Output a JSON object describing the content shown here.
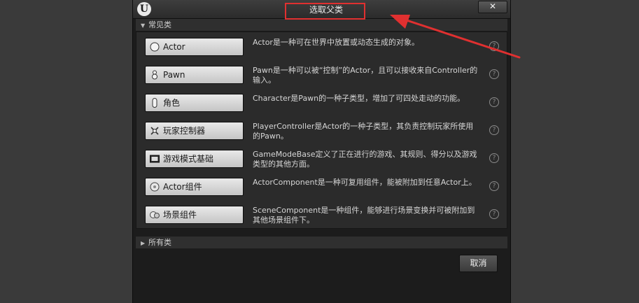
{
  "window": {
    "title": "选取父类",
    "close_label": "✕"
  },
  "common_section": {
    "label": "常见类"
  },
  "all_section": {
    "label": "所有类"
  },
  "classes": [
    {
      "label": "Actor",
      "icon": "actor-sphere-icon",
      "description": "Actor是一种可在世界中放置或动态生成的对象。"
    },
    {
      "label": "Pawn",
      "icon": "pawn-figure-icon",
      "description": "Pawn是一种可以被“控制”的Actor，且可以接收来自Controller的输入。"
    },
    {
      "label": "角色",
      "icon": "character-capsule-icon",
      "description": "Character是Pawn的一种子类型，增加了可四处走动的功能。"
    },
    {
      "label": "玩家控制器",
      "icon": "player-controller-icon",
      "description": "PlayerController是Actor的一种子类型，其负责控制玩家所使用的Pawn。"
    },
    {
      "label": "游戏模式基础",
      "icon": "game-mode-icon",
      "description": "GameModeBase定义了正在进行的游戏、其规则、得分以及游戏类型的其他方面。"
    },
    {
      "label": "Actor组件",
      "icon": "actor-component-icon",
      "description": "ActorComponent是一种可复用组件，能被附加到任意Actor上。"
    },
    {
      "label": "场景组件",
      "icon": "scene-component-icon",
      "description": "SceneComponent是一种组件，能够进行场景变换并可被附加到其他场景组件下。"
    }
  ],
  "help_glyph": "?",
  "footer": {
    "cancel_label": "取消"
  },
  "colors": {
    "annotation": "#e03030"
  }
}
